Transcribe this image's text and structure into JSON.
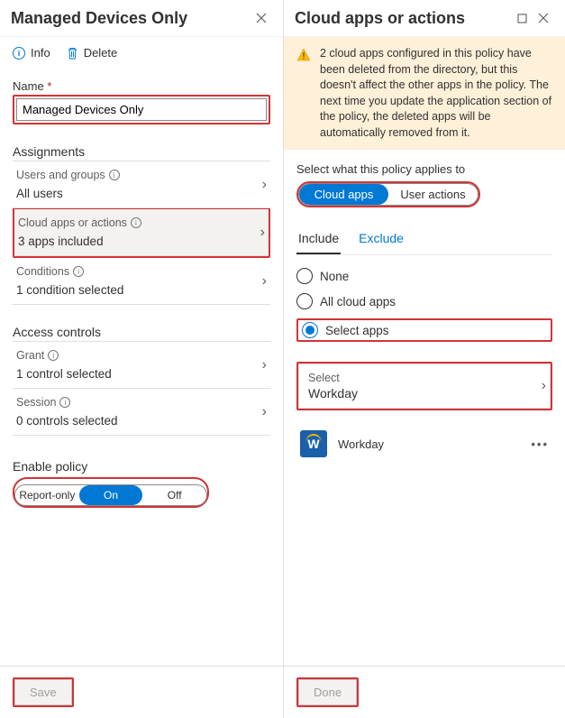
{
  "left": {
    "title": "Managed Devices Only",
    "toolbar": {
      "info": "Info",
      "delete": "Delete"
    },
    "name_label": "Name",
    "name_value": "Managed Devices Only",
    "sections": {
      "assignments": "Assignments",
      "access_controls": "Access controls"
    },
    "rows": {
      "users_groups": {
        "label": "Users and groups",
        "value": "All users"
      },
      "cloud_apps": {
        "label": "Cloud apps or actions",
        "value": "3 apps included"
      },
      "conditions": {
        "label": "Conditions",
        "value": "1 condition selected"
      },
      "grant": {
        "label": "Grant",
        "value": "1 control selected"
      },
      "session": {
        "label": "Session",
        "value": "0 controls selected"
      }
    },
    "enable_policy_label": "Enable policy",
    "enable_options": {
      "report": "Report-only",
      "on": "On",
      "off": "Off"
    },
    "save": "Save"
  },
  "right": {
    "title": "Cloud apps or actions",
    "warning": "2 cloud apps configured in this policy have been deleted from the directory, but this doesn't affect the other apps in the policy. The next time you update the application section of the policy, the deleted apps will be automatically removed from it.",
    "applies_label": "Select what this policy applies to",
    "applies_options": {
      "cloud_apps": "Cloud apps",
      "user_actions": "User actions"
    },
    "tabs": {
      "include": "Include",
      "exclude": "Exclude"
    },
    "radios": {
      "none": "None",
      "all": "All cloud apps",
      "select": "Select apps"
    },
    "select_box": {
      "label": "Select",
      "value": "Workday"
    },
    "app": {
      "name": "Workday",
      "letter": "W"
    },
    "done": "Done"
  }
}
